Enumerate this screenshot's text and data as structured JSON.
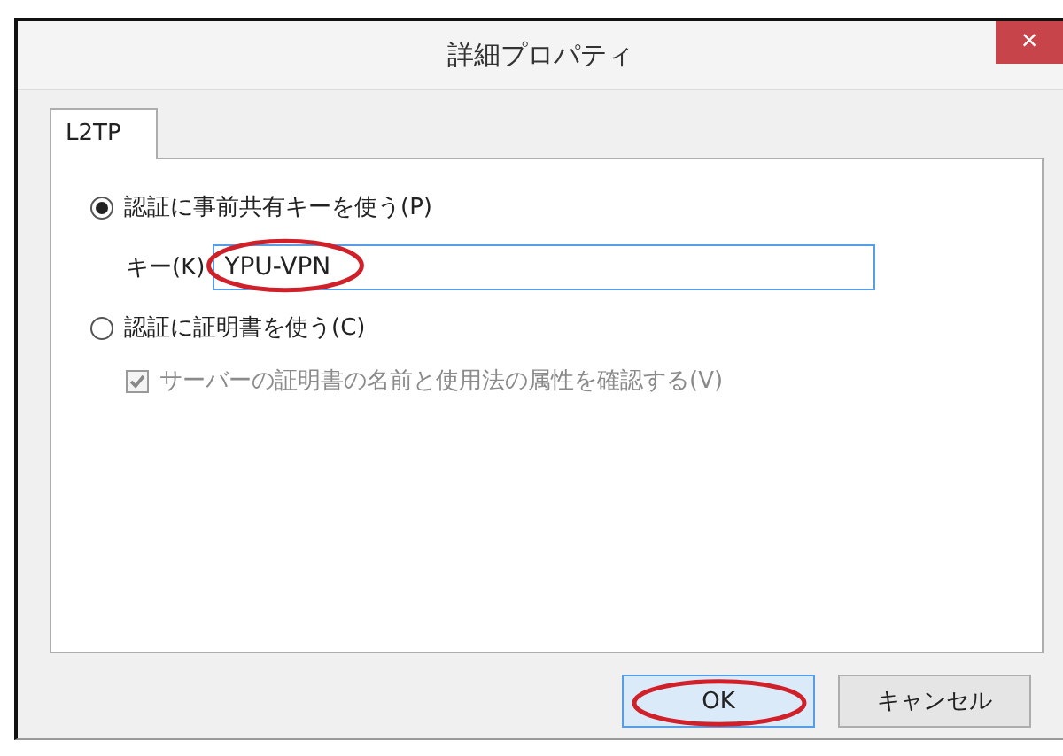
{
  "window": {
    "title": "詳細プロパティ",
    "close": "×"
  },
  "tabs": [
    {
      "label": "L2TP",
      "selected": true
    }
  ],
  "options": [
    {
      "kind": "radio",
      "label": "認証に事前共有キーを使う(P)",
      "selected": true
    },
    {
      "kind": "field",
      "label": "キー(K)",
      "value": "YPU-VPN",
      "annotated": true
    },
    {
      "kind": "radio",
      "label": "認証に証明書を使う(C)",
      "selected": false
    },
    {
      "kind": "checkbox",
      "label": "サーバーの証明書の名前と使用法の属性を確認する(V)",
      "checked": true,
      "disabled": true
    }
  ],
  "buttons": [
    {
      "label": "OK",
      "default": true,
      "annotated": true
    },
    {
      "label": "キャンセル",
      "default": false,
      "annotated": false
    }
  ]
}
